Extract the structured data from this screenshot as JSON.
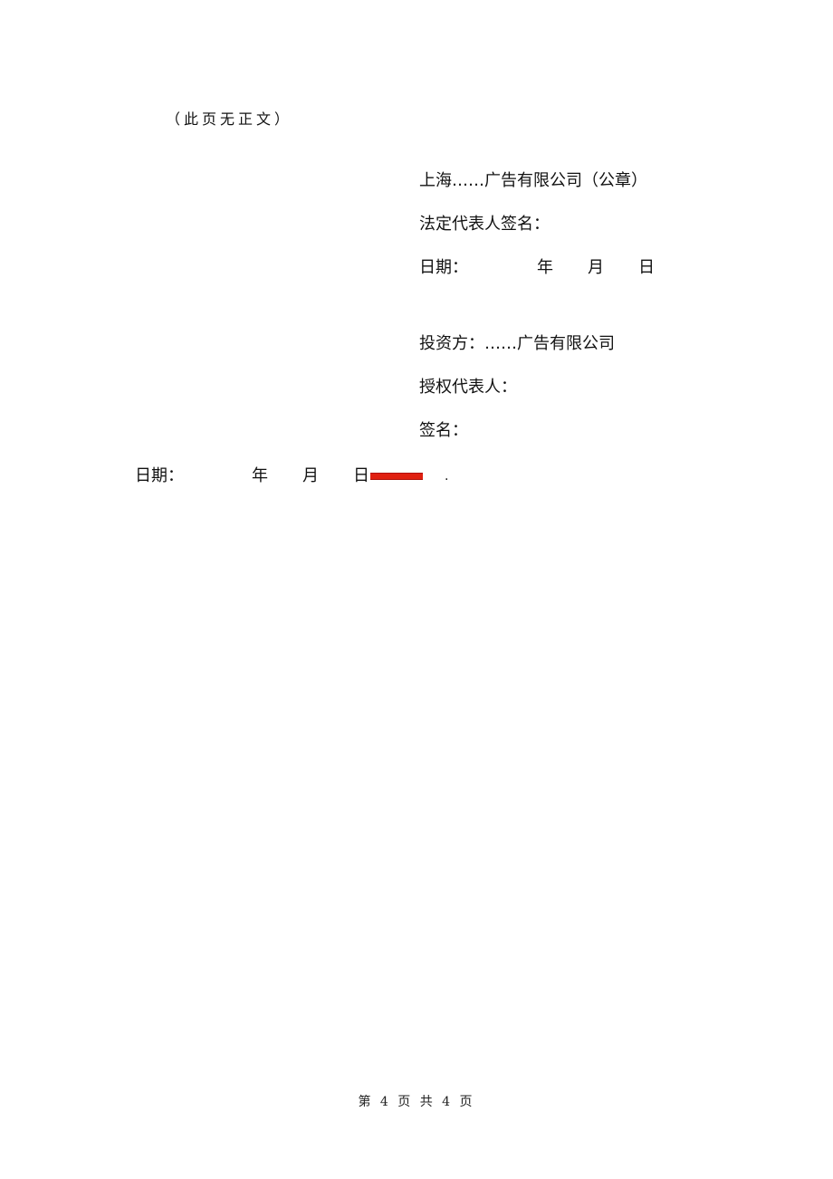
{
  "note": "（此页无正文）",
  "party_a": {
    "company": "上海……广告有限公司（公章）",
    "signature_label": "法定代表人签名：",
    "date_label": "日期：",
    "year": "年",
    "month": "月",
    "day": "日"
  },
  "party_b": {
    "company": "投资方：……广告有限公司",
    "representative_label": "授权代表人：",
    "signature_label": "签名："
  },
  "bottom_date": {
    "date_label": "日期：",
    "year": "年",
    "month": "月",
    "day": "日",
    "trailing": "."
  },
  "footer": {
    "page_text": "第 4 页 共 4 页"
  },
  "colors": {
    "redaction": "#e02010"
  }
}
